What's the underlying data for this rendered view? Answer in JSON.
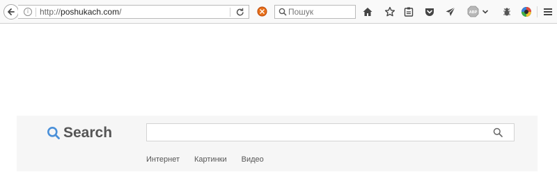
{
  "browser": {
    "url_prefix": "http://",
    "url_host": "poshukach.com",
    "url_suffix": "/",
    "search_placeholder": "Пошук",
    "abp_label": "ABP",
    "icons": [
      "back-arrow-icon",
      "info-icon",
      "reload-icon",
      "stop-extension-icon",
      "search-icon",
      "home-icon",
      "bookmark-star-icon",
      "reading-list-icon",
      "pocket-icon",
      "send-icon",
      "adblock-plus-icon",
      "dropdown-arrow-icon",
      "extension-bug-icon",
      "color-wheel-icon",
      "hamburger-menu-icon"
    ]
  },
  "page": {
    "brand_label": "Search",
    "brand_color": "#4a90d9",
    "search_value": "",
    "nav_links": [
      "Интернет",
      "Картинки",
      "Видео"
    ]
  }
}
